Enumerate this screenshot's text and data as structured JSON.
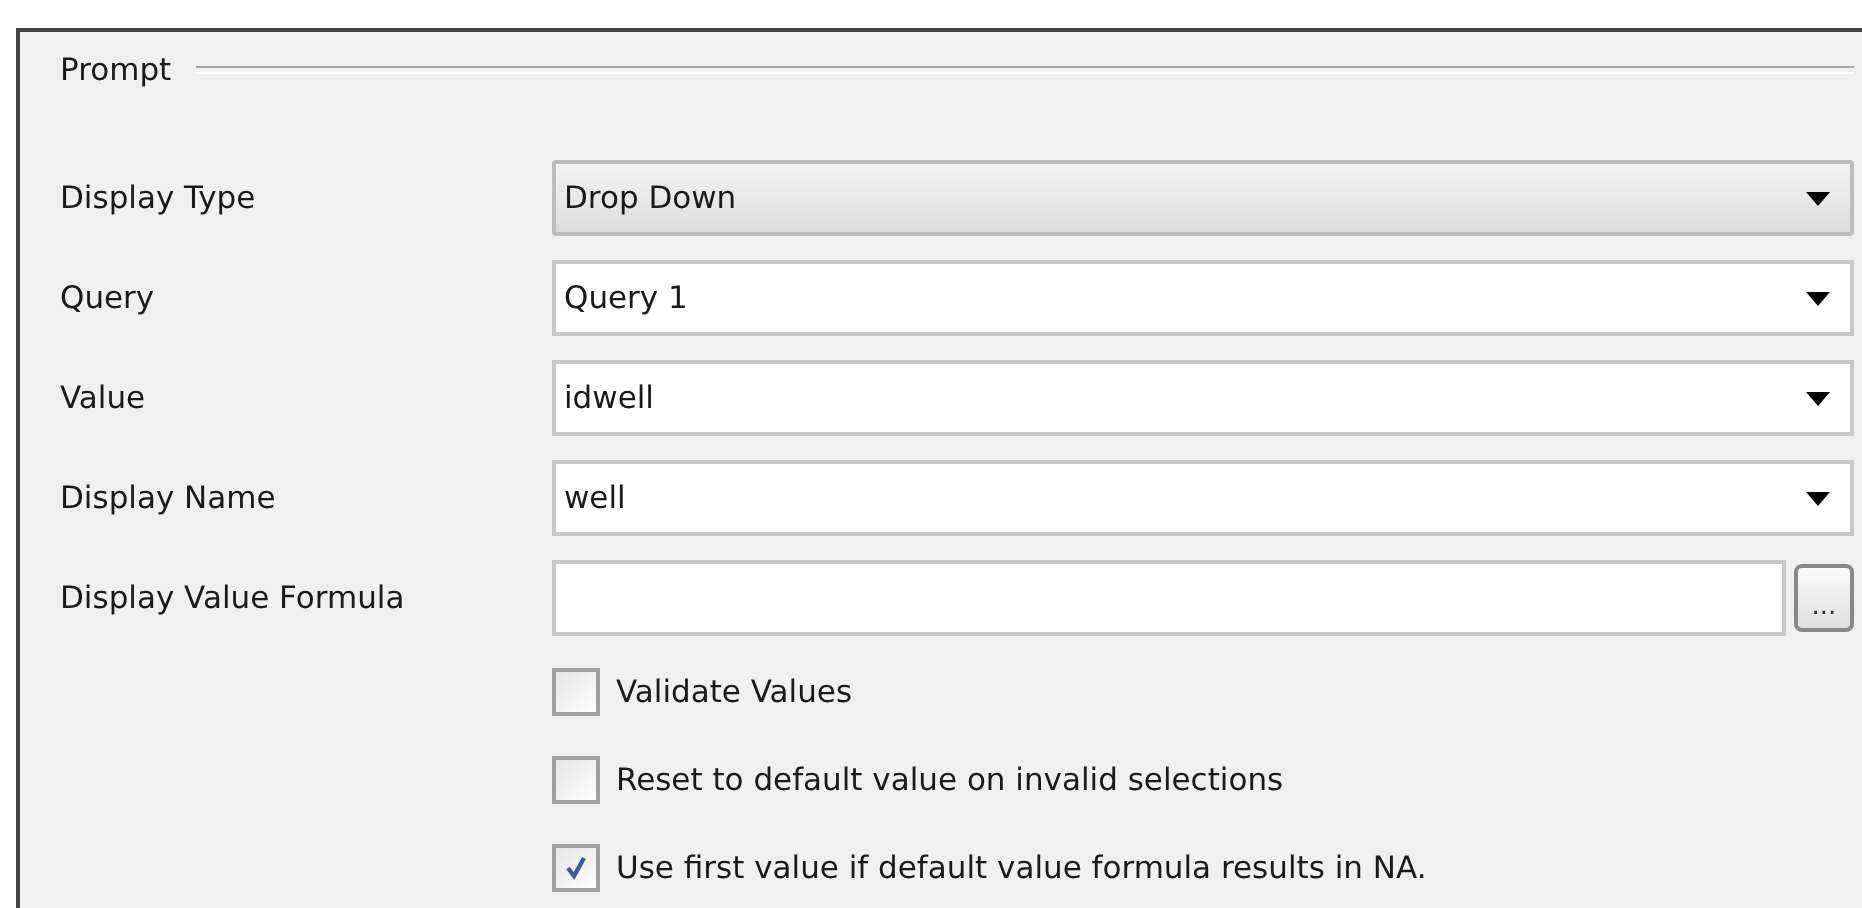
{
  "section": {
    "title": "Prompt"
  },
  "fields": [
    {
      "label": "Display Type",
      "kind": "select",
      "value": "Drop Down"
    },
    {
      "label": "Query",
      "kind": "combo",
      "value": "Query 1"
    },
    {
      "label": "Value",
      "kind": "combo",
      "value": "idwell"
    },
    {
      "label": "Display Name",
      "kind": "combo",
      "value": "well"
    },
    {
      "label": "Display Value Formula",
      "kind": "formula",
      "button": "..."
    }
  ],
  "options": [
    {
      "label": "Validate Values",
      "checked": false
    },
    {
      "label": "Reset to default value on invalid selections",
      "checked": false
    },
    {
      "label": "Use first value if default value formula results in NA.",
      "checked": true
    }
  ]
}
